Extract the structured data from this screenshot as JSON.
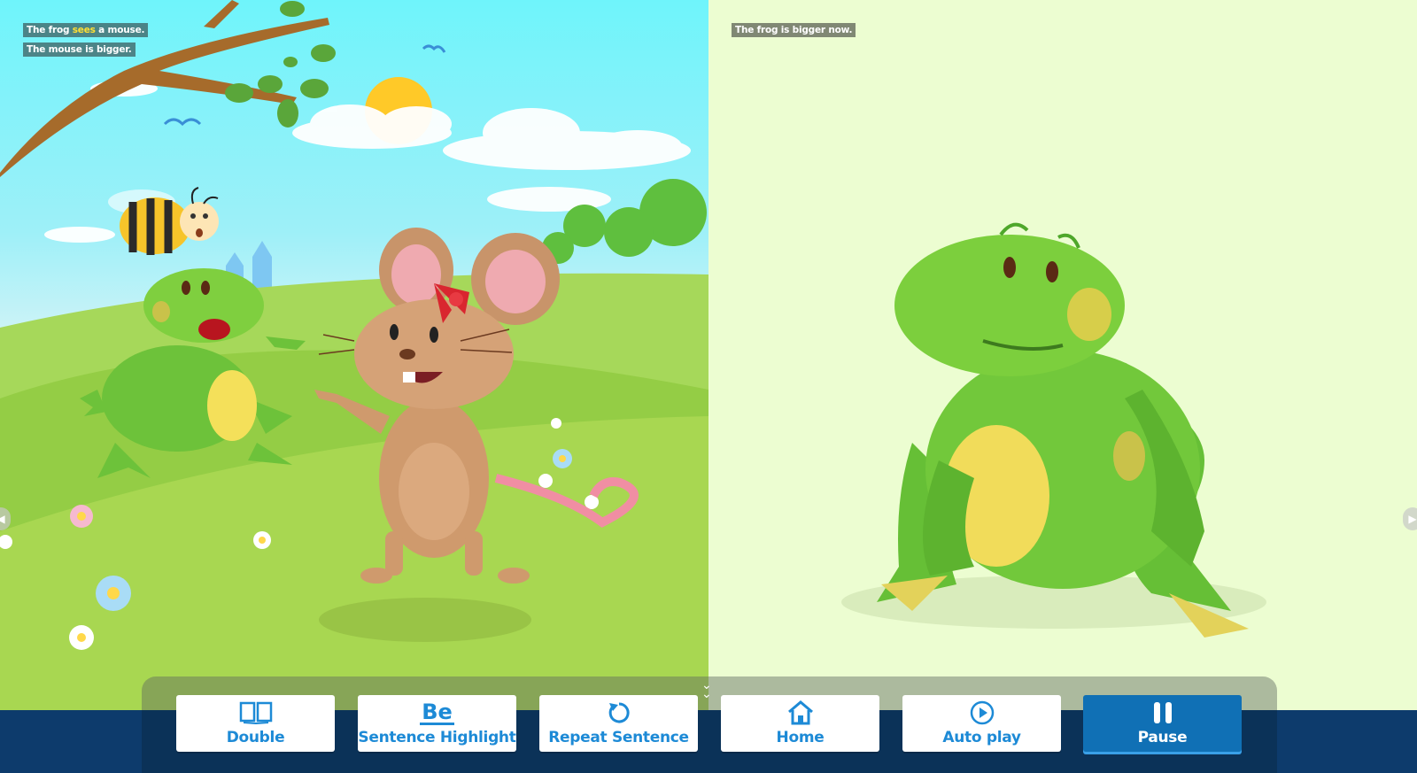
{
  "left_page": {
    "caption_line1_before": "The frog ",
    "caption_line1_highlight": "sees",
    "caption_line1_after": " a mouse.",
    "caption_line2": "The mouse is bigger."
  },
  "right_page": {
    "caption_line1": "The frog is bigger now."
  },
  "navigation": {
    "prev_icon": "chevron-left-icon",
    "next_icon": "chevron-right-icon",
    "collapse_icon": "double-chevron-down-icon"
  },
  "toolbar": {
    "buttons": [
      {
        "label": "Double",
        "icon": "open-book-icon",
        "active": false
      },
      {
        "label": "Sentence Highlight",
        "icon": "text-underline-icon",
        "glyph": "Be",
        "active": false
      },
      {
        "label": "Repeat Sentence",
        "icon": "repeat-icon",
        "active": false
      },
      {
        "label": "Home",
        "icon": "home-icon",
        "active": false
      },
      {
        "label": "Auto play",
        "icon": "play-circle-icon",
        "active": false
      },
      {
        "label": "Pause",
        "icon": "pause-icon",
        "active": true
      }
    ]
  },
  "colors": {
    "button_text": "#1d8ad6",
    "active_button": "#1070b5",
    "bottom_bar": "#0d3b6c",
    "highlight_word": "#ffe033"
  }
}
